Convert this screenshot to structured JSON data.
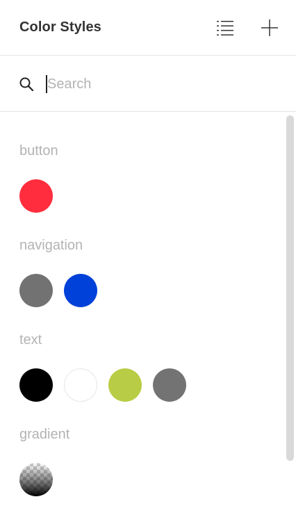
{
  "header": {
    "title": "Color Styles",
    "list_icon": "list-view-icon",
    "add_icon": "plus-icon"
  },
  "search": {
    "placeholder": "Search",
    "value": "",
    "icon": "search-icon"
  },
  "groups": [
    {
      "label": "button",
      "swatches": [
        {
          "color": "#ff2d3d"
        }
      ]
    },
    {
      "label": "navigation",
      "swatches": [
        {
          "color": "#727272"
        },
        {
          "color": "#0041d9"
        }
      ]
    },
    {
      "label": "text",
      "swatches": [
        {
          "color": "#000000"
        },
        {
          "color": "#ffffff"
        },
        {
          "color": "#b9cc45"
        },
        {
          "color": "#737373"
        }
      ]
    },
    {
      "label": "gradient",
      "swatches": [
        {
          "type": "gradient",
          "from": "rgba(0,0,0,0)",
          "to": "#000000"
        }
      ]
    }
  ]
}
